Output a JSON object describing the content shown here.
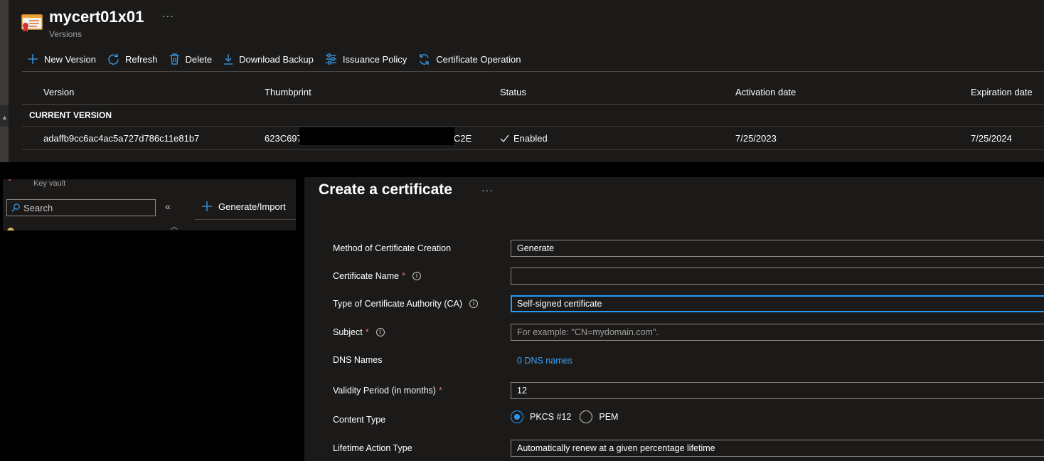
{
  "header": {
    "title": "mycert01x01",
    "subtitle": "Versions",
    "more": "···"
  },
  "toolbar": {
    "new_version": "New Version",
    "refresh": "Refresh",
    "delete": "Delete",
    "download_backup": "Download Backup",
    "issuance_policy": "Issuance Policy",
    "certificate_operation": "Certificate Operation"
  },
  "grid": {
    "columns": [
      "Version",
      "Thumbprint",
      "Status",
      "Activation date",
      "Expiration date"
    ],
    "group_label": "CURRENT VERSION",
    "rows": [
      {
        "version": "adaffb9cc6ac4ac5a727d786c11e81b7",
        "thumbprint_start": "623C697",
        "thumbprint_end": "C2E",
        "status": "Enabled",
        "activation": "7/25/2023",
        "expiration": "7/25/2024"
      }
    ]
  },
  "sidebar": {
    "breadcrumb": "Key vault",
    "search_placeholder": "Search",
    "collapse": "«",
    "generate_import": "Generate/Import"
  },
  "form": {
    "title": "Create a certificate",
    "more": "···",
    "fields": {
      "method": {
        "label": "Method of Certificate Creation",
        "value": "Generate"
      },
      "name": {
        "label": "Certificate Name",
        "value": ""
      },
      "ca_type": {
        "label": "Type of Certificate Authority (CA)",
        "value": "Self-signed certificate"
      },
      "subject": {
        "label": "Subject",
        "placeholder": "For example: \"CN=mydomain.com\"."
      },
      "dns": {
        "label": "DNS Names",
        "link": "0 DNS names"
      },
      "validity": {
        "label": "Validity Period (in months)",
        "value": "12"
      },
      "content_type": {
        "label": "Content Type",
        "options": [
          "PKCS #12",
          "PEM"
        ],
        "selected": "PKCS #12"
      },
      "lifetime": {
        "label": "Lifetime Action Type",
        "value": "Automatically renew at a given percentage lifetime"
      }
    },
    "required_mark": "*",
    "info_mark": "i"
  },
  "colors": {
    "accent": "#2899f5",
    "link": "#3aa0f3",
    "required": "#f1707b",
    "panel_bg": "#1b1a19"
  }
}
